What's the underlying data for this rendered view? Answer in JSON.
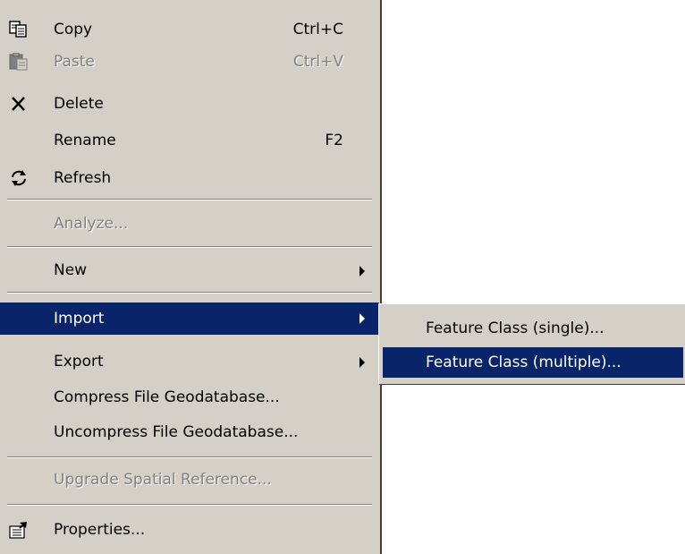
{
  "context_menu": {
    "items": [
      {
        "label": "Copy",
        "shortcut": "Ctrl+C",
        "icon": "copy-icon",
        "enabled": true
      },
      {
        "label": "Paste",
        "shortcut": "Ctrl+V",
        "icon": "paste-icon",
        "enabled": false
      },
      {
        "label": "Delete",
        "shortcut": "",
        "icon": "delete-icon",
        "enabled": true
      },
      {
        "label": "Rename",
        "shortcut": "F2",
        "icon": "",
        "enabled": true
      },
      {
        "label": "Refresh",
        "shortcut": "",
        "icon": "refresh-icon",
        "enabled": true
      },
      {
        "label": "Analyze...",
        "shortcut": "",
        "icon": "",
        "enabled": false
      },
      {
        "label": "New",
        "shortcut": "",
        "icon": "",
        "enabled": true,
        "has_submenu": true
      },
      {
        "label": "Import",
        "shortcut": "",
        "icon": "",
        "enabled": true,
        "has_submenu": true,
        "selected": true
      },
      {
        "label": "Export",
        "shortcut": "",
        "icon": "",
        "enabled": true,
        "has_submenu": true
      },
      {
        "label": "Compress File Geodatabase...",
        "shortcut": "",
        "icon": "",
        "enabled": true
      },
      {
        "label": "Uncompress File Geodatabase...",
        "shortcut": "",
        "icon": "",
        "enabled": true
      },
      {
        "label": "Upgrade Spatial Reference...",
        "shortcut": "",
        "icon": "",
        "enabled": false
      },
      {
        "label": "Properties...",
        "shortcut": "",
        "icon": "properties-icon",
        "enabled": true
      }
    ]
  },
  "import_submenu": {
    "items": [
      {
        "label": "Feature Class (single)...",
        "selected": false
      },
      {
        "label": "Feature Class (multiple)...",
        "selected": true
      }
    ]
  },
  "colors": {
    "menu_bg": "#d4d0c8",
    "highlight_bg": "#0a246a",
    "disabled_text": "#808080"
  }
}
